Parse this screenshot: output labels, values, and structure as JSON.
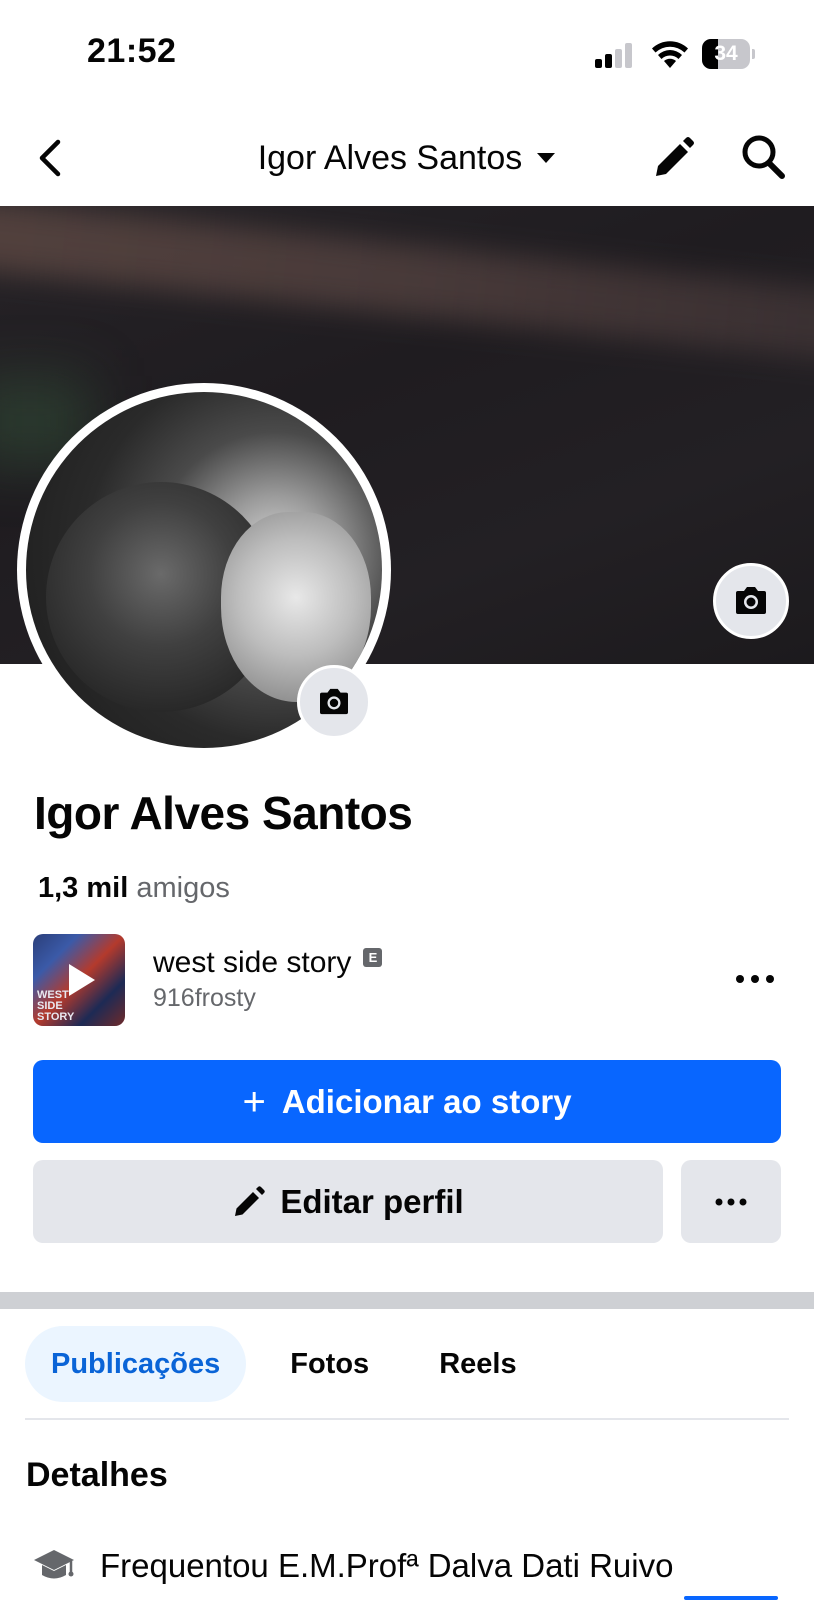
{
  "status_bar": {
    "time": "21:52",
    "battery": "34",
    "battery_level_percent": 34,
    "signal_bars_filled": 2,
    "signal_bars_total": 4
  },
  "nav": {
    "title": "Igor Alves Santos",
    "icons": [
      "back-chevron-icon",
      "caret-down-icon",
      "pencil-icon",
      "search-icon"
    ]
  },
  "profile": {
    "name": "Igor Alves Santos",
    "friends_count": "1,3 mil",
    "friends_label": "amigos"
  },
  "music": {
    "album_art_text": "WEST SIDE STORY",
    "song_title": "west side story",
    "explicit_badge": "E",
    "artist": "916frosty"
  },
  "buttons": {
    "add_story": "Adicionar ao story",
    "add_story_icon": "+",
    "edit_profile": "Editar perfil"
  },
  "tabs": [
    {
      "label": "Publicações",
      "active": true
    },
    {
      "label": "Fotos",
      "active": false
    },
    {
      "label": "Reels",
      "active": false
    }
  ],
  "details": {
    "title": "Detalhes",
    "items": [
      {
        "icon": "graduation-cap-icon",
        "text": "Frequentou E.M.Profª Dalva Dati Ruivo"
      }
    ]
  },
  "colors": {
    "primary_blue": "#0866ff",
    "active_tab_bg": "#ebf5ff",
    "active_tab_text": "#0a64d7",
    "secondary_button_bg": "#e4e6eb",
    "muted_text": "#65676b"
  }
}
